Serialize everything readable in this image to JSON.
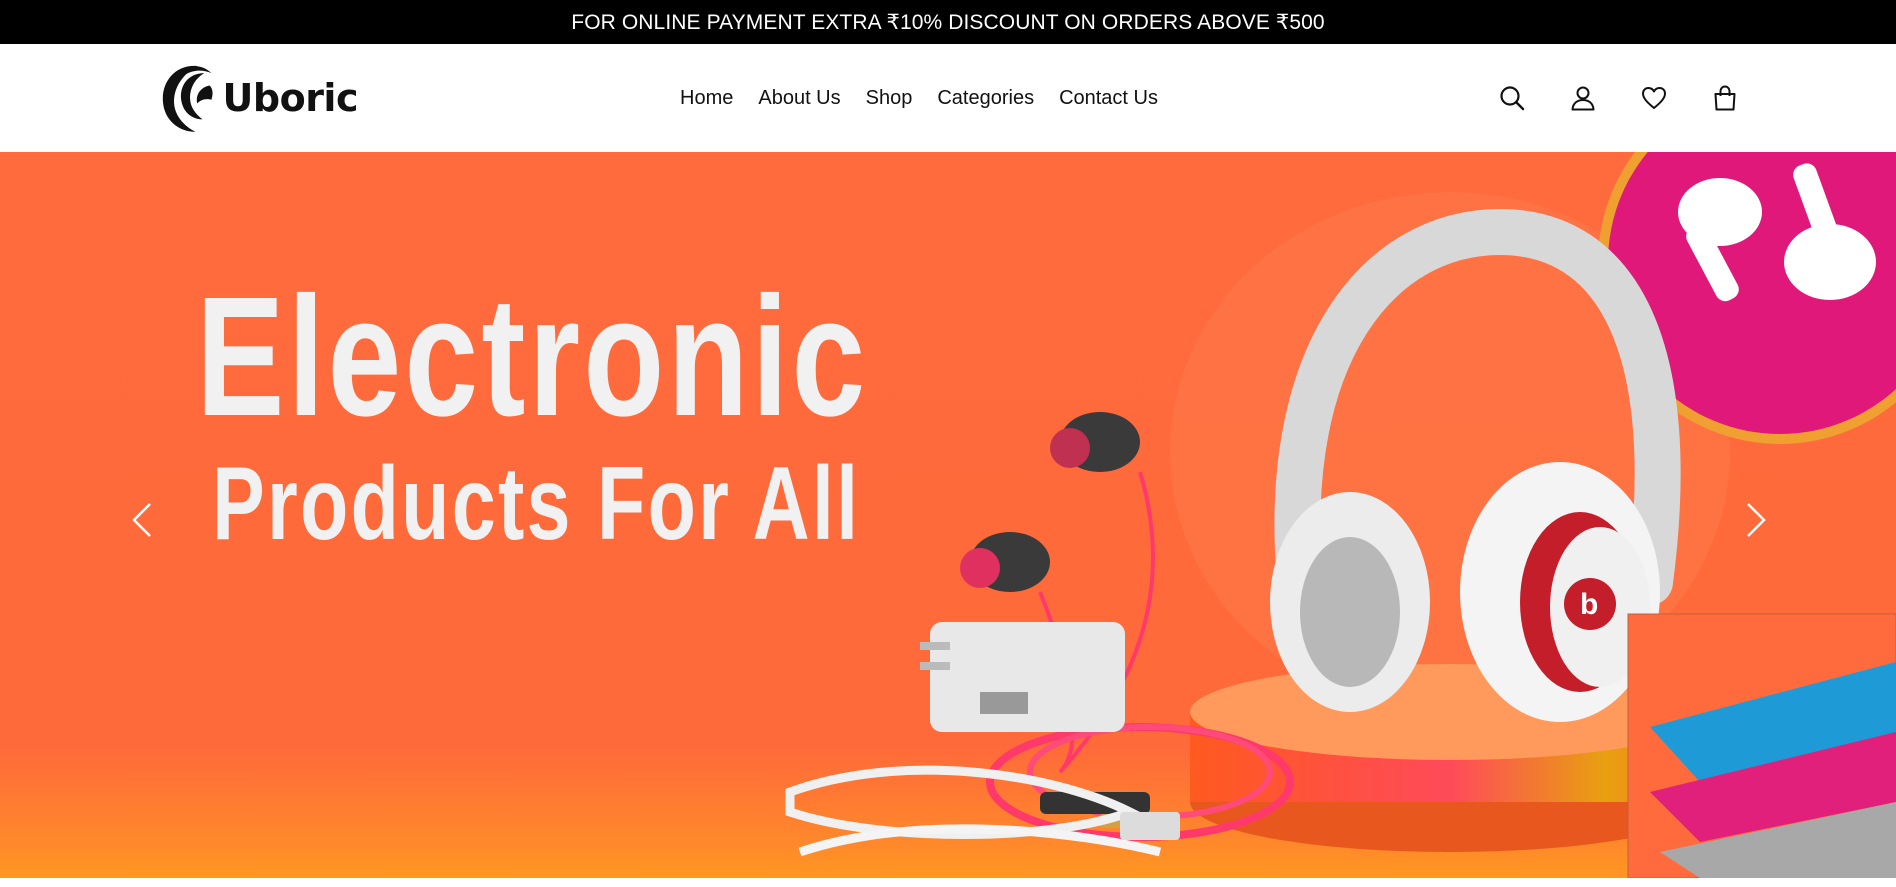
{
  "promo": {
    "text": "FOR ONLINE PAYMENT EXTRA ₹10% DISCOUNT ON ORDERS ABOVE ₹500"
  },
  "header": {
    "logo_text": "Uboric",
    "nav": [
      {
        "label": "Home"
      },
      {
        "label": "About Us"
      },
      {
        "label": "Shop"
      },
      {
        "label": "Categories"
      },
      {
        "label": "Contact Us"
      }
    ],
    "icons": [
      "search-icon",
      "user-icon",
      "heart-icon",
      "bag-icon"
    ]
  },
  "hero": {
    "title_line1": "Electronic",
    "title_line2": "Products For All",
    "background_color": "#ff6b3d",
    "accent_pink": "#e0187a"
  }
}
